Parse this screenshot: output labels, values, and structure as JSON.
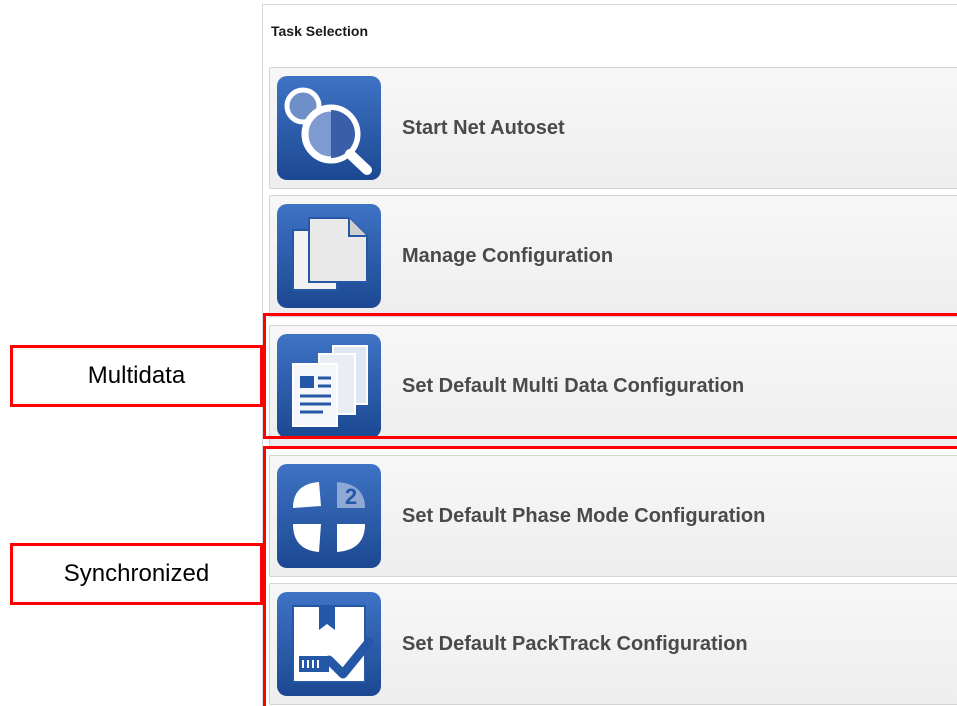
{
  "panel": {
    "title": "Task Selection"
  },
  "tasks": [
    {
      "label": "Start Net Autoset",
      "icon": "magnifier-icon"
    },
    {
      "label": "Manage Configuration",
      "icon": "document-stack-icon"
    },
    {
      "label": "Set Default Multi Data Configuration",
      "icon": "multi-document-icon"
    },
    {
      "label": "Set Default Phase Mode Configuration",
      "icon": "phase-mode-2-icon"
    },
    {
      "label": "Set Default PackTrack Configuration",
      "icon": "packtrack-check-icon"
    }
  ],
  "annotations": {
    "multidata": "Multidata",
    "synchronized": "Synchronized"
  },
  "colors": {
    "icon_blue": "#2557a7",
    "annotation_red": "#ff0000",
    "label_gray": "#4a4a4a"
  }
}
